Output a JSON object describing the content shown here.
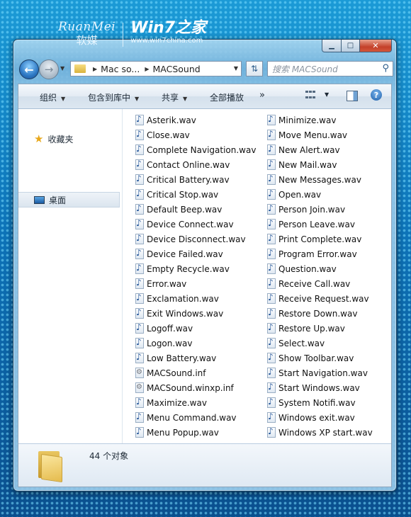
{
  "watermark": {
    "brand_en": "RuanMei",
    "brand_cn": "软媒",
    "site_title": "Win7之家",
    "site_url": "www.win7china.com"
  },
  "window": {
    "caption_buttons": {
      "minimize": "▁",
      "maximize": "□",
      "close": "✕"
    }
  },
  "address_bar": {
    "segments": [
      "Mac so...",
      "MACSound"
    ],
    "search_placeholder": "搜索 MACSound",
    "icons": {
      "back": "back-arrow-icon",
      "forward": "forward-arrow-icon",
      "refresh": "refresh-icon",
      "search": "search-icon"
    }
  },
  "toolbar": {
    "organize": "组织",
    "include_in_library": "包含到库中",
    "share": "共享",
    "play_all": "全部播放",
    "more": "»"
  },
  "nav_pane": {
    "favorites": "收藏夹",
    "desktop": "桌面"
  },
  "files": {
    "column1": [
      {
        "name": "Asterik.wav",
        "type": "wav"
      },
      {
        "name": "Close.wav",
        "type": "wav"
      },
      {
        "name": "Complete Navigation.wav",
        "type": "wav"
      },
      {
        "name": "Contact Online.wav",
        "type": "wav"
      },
      {
        "name": "Critical Battery.wav",
        "type": "wav"
      },
      {
        "name": "Critical Stop.wav",
        "type": "wav"
      },
      {
        "name": "Default Beep.wav",
        "type": "wav"
      },
      {
        "name": "Device Connect.wav",
        "type": "wav"
      },
      {
        "name": "Device Disconnect.wav",
        "type": "wav"
      },
      {
        "name": "Device Failed.wav",
        "type": "wav"
      },
      {
        "name": "Empty Recycle.wav",
        "type": "wav"
      },
      {
        "name": "Error.wav",
        "type": "wav"
      },
      {
        "name": "Exclamation.wav",
        "type": "wav"
      },
      {
        "name": "Exit Windows.wav",
        "type": "wav"
      },
      {
        "name": "Logoff.wav",
        "type": "wav"
      },
      {
        "name": "Logon.wav",
        "type": "wav"
      },
      {
        "name": "Low Battery.wav",
        "type": "wav"
      },
      {
        "name": "MACSound.inf",
        "type": "inf"
      },
      {
        "name": "MACSound.winxp.inf",
        "type": "inf"
      },
      {
        "name": "Maximize.wav",
        "type": "wav"
      },
      {
        "name": "Menu Command.wav",
        "type": "wav"
      },
      {
        "name": "Menu Popup.wav",
        "type": "wav"
      }
    ],
    "column2": [
      {
        "name": "Minimize.wav",
        "type": "wav"
      },
      {
        "name": "Move Menu.wav",
        "type": "wav"
      },
      {
        "name": "New Alert.wav",
        "type": "wav"
      },
      {
        "name": "New Mail.wav",
        "type": "wav"
      },
      {
        "name": "New Messages.wav",
        "type": "wav"
      },
      {
        "name": "Open.wav",
        "type": "wav"
      },
      {
        "name": "Person Join.wav",
        "type": "wav"
      },
      {
        "name": "Person Leave.wav",
        "type": "wav"
      },
      {
        "name": "Print Complete.wav",
        "type": "wav"
      },
      {
        "name": "Program Error.wav",
        "type": "wav"
      },
      {
        "name": "Question.wav",
        "type": "wav"
      },
      {
        "name": "Receive Call.wav",
        "type": "wav"
      },
      {
        "name": "Receive Request.wav",
        "type": "wav"
      },
      {
        "name": "Restore Down.wav",
        "type": "wav"
      },
      {
        "name": "Restore Up.wav",
        "type": "wav"
      },
      {
        "name": "Select.wav",
        "type": "wav"
      },
      {
        "name": "Show Toolbar.wav",
        "type": "wav"
      },
      {
        "name": "Start Navigation.wav",
        "type": "wav"
      },
      {
        "name": "Start Windows.wav",
        "type": "wav"
      },
      {
        "name": "System Notifi.wav",
        "type": "wav"
      },
      {
        "name": "Windows exit.wav",
        "type": "wav"
      },
      {
        "name": "Windows XP start.wav",
        "type": "wav"
      }
    ]
  },
  "details_pane": {
    "item_count": "44 个对象"
  }
}
